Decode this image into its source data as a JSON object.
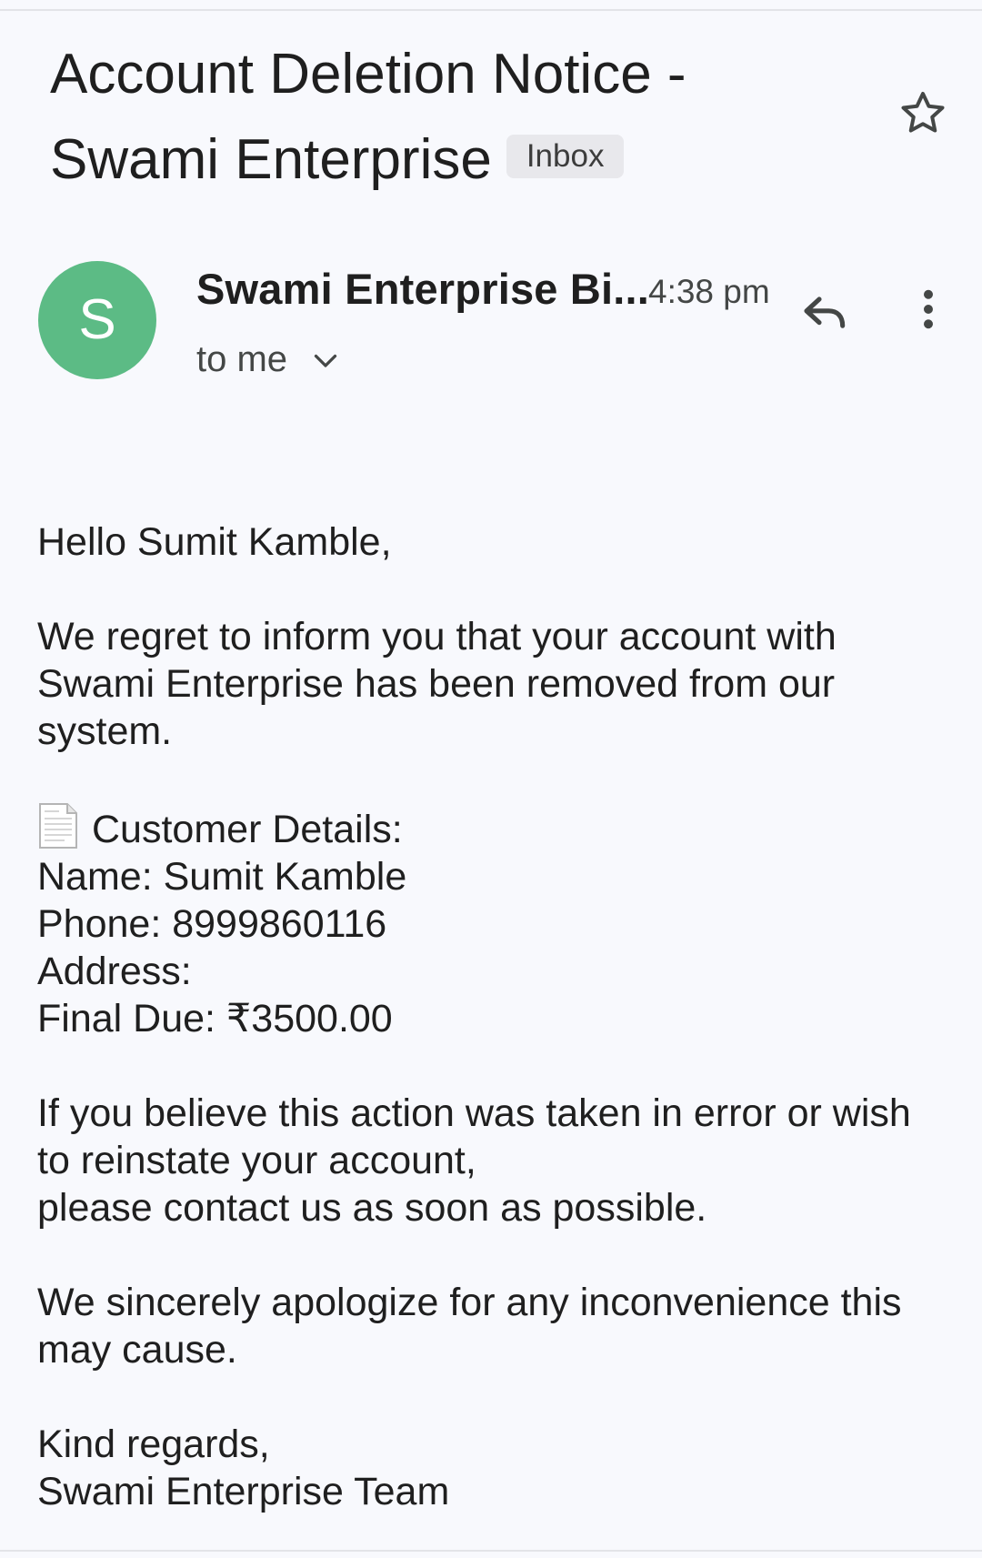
{
  "email": {
    "subject_line1": "Account Deletion Notice -",
    "subject_line2": "Swami Enterprise",
    "label": "Inbox",
    "sender_initial": "S",
    "sender_name": "Swami Enterprise Bi...",
    "time": "4:38 pm",
    "recipient": "to me"
  },
  "body": {
    "greeting": "Hello Sumit Kamble,",
    "paragraph1_line1": "We regret to inform you that your account with",
    "paragraph1_line2": "Swami Enterprise has been removed from our",
    "paragraph1_line3": "system.",
    "details_heading": "Customer Details:",
    "name": "Name: Sumit Kamble",
    "phone": "Phone: 8999860116",
    "address": "Address:",
    "final_due": "Final Due: ₹3500.00",
    "paragraph2_line1": "If you believe this action was taken in error or wish",
    "paragraph2_line2": "to reinstate your account,",
    "paragraph2_line3": "please contact us as soon as possible.",
    "paragraph3_line1": "We sincerely apologize for any inconvenience this",
    "paragraph3_line2": "may cause.",
    "closing": "Kind regards,",
    "signature": "Swami Enterprise Team"
  },
  "icons": {
    "star": "star-outline-icon",
    "reply": "reply-icon",
    "more": "more-vertical-icon",
    "chevron": "chevron-down-icon",
    "details": "document-icon"
  },
  "colors": {
    "avatar_bg": "#5cbb85",
    "page_bg": "#f8f9fd",
    "badge_bg": "#e8e8ec"
  }
}
